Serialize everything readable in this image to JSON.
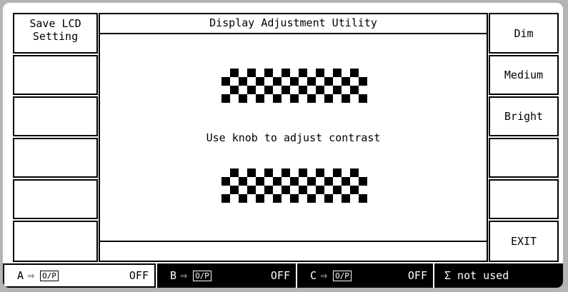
{
  "left_softkeys": [
    "Save LCD\nSetting",
    "",
    "",
    "",
    "",
    ""
  ],
  "right_softkeys": [
    "Dim",
    "Medium",
    "Bright",
    "",
    "",
    "EXIT"
  ],
  "main": {
    "title": "Display Adjustment Utility",
    "instruction": "Use knob to adjust contrast"
  },
  "status": {
    "a": {
      "label": "A",
      "arrow": "⇨",
      "output": "O/P",
      "state": "OFF"
    },
    "b": {
      "label": "B",
      "arrow": "⇨",
      "output": "O/P",
      "state": "OFF"
    },
    "c": {
      "label": "C",
      "arrow": "⇨",
      "output": "O/P",
      "state": "OFF"
    },
    "sigma": "Σ not used"
  },
  "colors": {
    "background": "#ffffff",
    "foreground": "#000000",
    "bezel": "#b4b4b4"
  }
}
